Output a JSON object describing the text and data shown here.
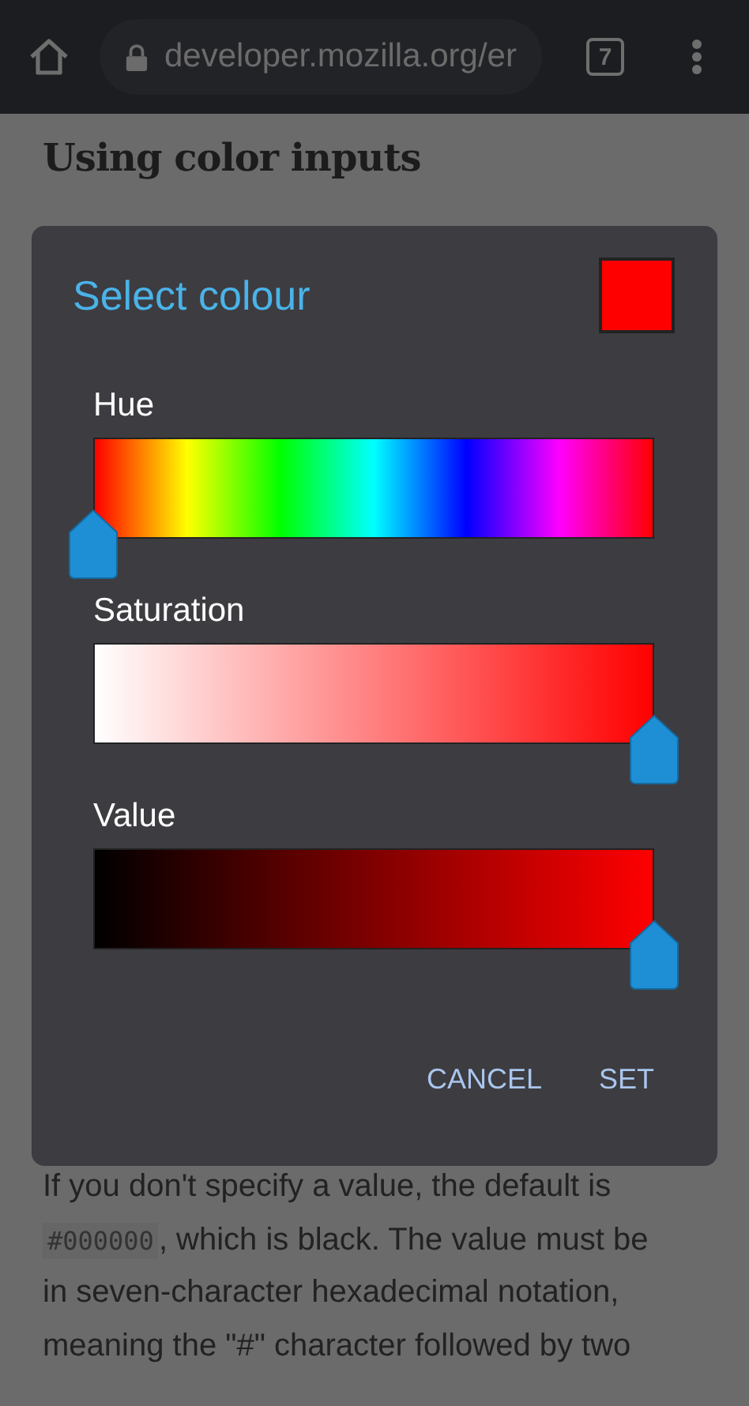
{
  "browser": {
    "url": "developer.mozilla.org/er",
    "tab_count": "7"
  },
  "page": {
    "heading": "Using color inputs",
    "code": "#000000",
    "paragraph_before_code": "If you don't specify a value, the default is",
    "paragraph_after_code": ", which is black. The value must be in seven-character hexadecimal notation, meaning the \"#\" character followed by two"
  },
  "dialog": {
    "title": "Select colour",
    "swatch": {
      "color": "#ff0000"
    },
    "sliders": [
      {
        "kind": "hue",
        "label": "Hue",
        "level": 0
      },
      {
        "kind": "saturation",
        "label": "Saturation",
        "level": 1
      },
      {
        "kind": "value",
        "label": "Value",
        "level": 1
      }
    ],
    "buttons": [
      "CANCEL",
      "SET"
    ]
  }
}
